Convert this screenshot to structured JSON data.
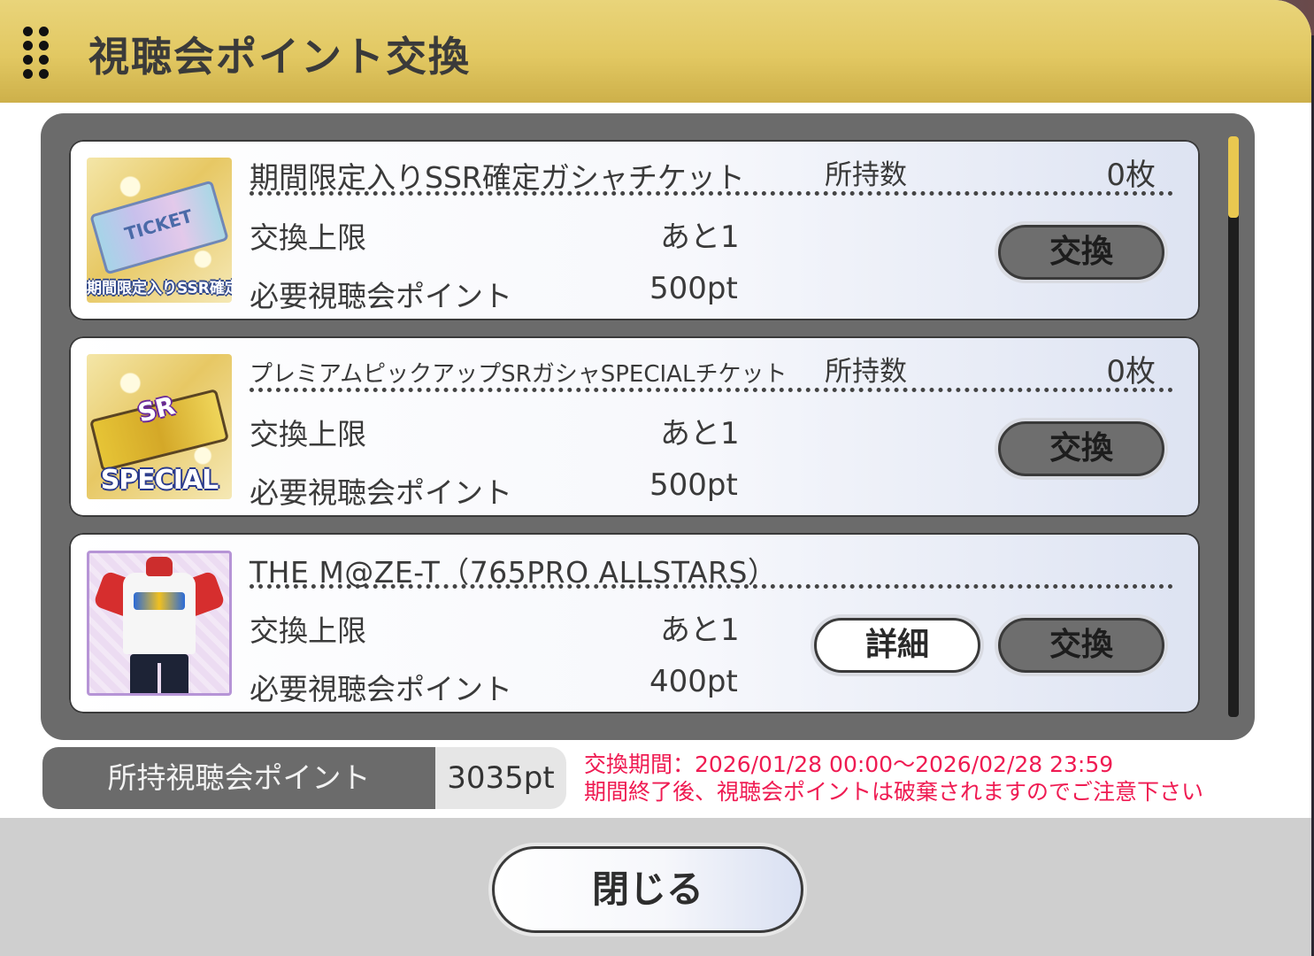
{
  "dialog": {
    "title": "視聴会ポイント交換"
  },
  "items": [
    {
      "name": "期間限定入りSSR確定ガシャチケット",
      "owned_label": "所持数",
      "owned_value": "0枚",
      "limit_label": "交換上限",
      "limit_value": "あと1",
      "cost_label": "必要視聴会ポイント",
      "cost_value": "500pt",
      "thumb_text": "TICKET",
      "thumb_caption": "期間限定入りSSR確定",
      "exchange_label": "交換"
    },
    {
      "name": "プレミアムピックアップSRガシャSPECIALチケット",
      "owned_label": "所持数",
      "owned_value": "0枚",
      "limit_label": "交換上限",
      "limit_value": "あと1",
      "cost_label": "必要視聴会ポイント",
      "cost_value": "500pt",
      "thumb_text": "SR",
      "thumb_caption": "SPECIAL",
      "exchange_label": "交換"
    },
    {
      "name": "THE M@ZE-T（765PRO ALLSTARS）",
      "limit_label": "交換上限",
      "limit_value": "あと1",
      "cost_label": "必要視聴会ポイント",
      "cost_value": "400pt",
      "detail_label": "詳細",
      "exchange_label": "交換"
    }
  ],
  "points": {
    "label": "所持視聴会ポイント",
    "value": "3035pt"
  },
  "notice": {
    "line1": "交換期間：2026/01/28 00:00～2026/02/28 23:59",
    "line2": "期間終了後、視聴会ポイントは破棄されますのでご注意下さい"
  },
  "footer": {
    "close_label": "閉じる"
  },
  "colors": {
    "header_gold": "#e2c862",
    "notice_red": "#ef1b52",
    "frame_gray": "#6b6b6b",
    "scroll_thumb": "#e9c850"
  },
  "icons": {
    "drag_handle": "drag-handle-icon"
  }
}
